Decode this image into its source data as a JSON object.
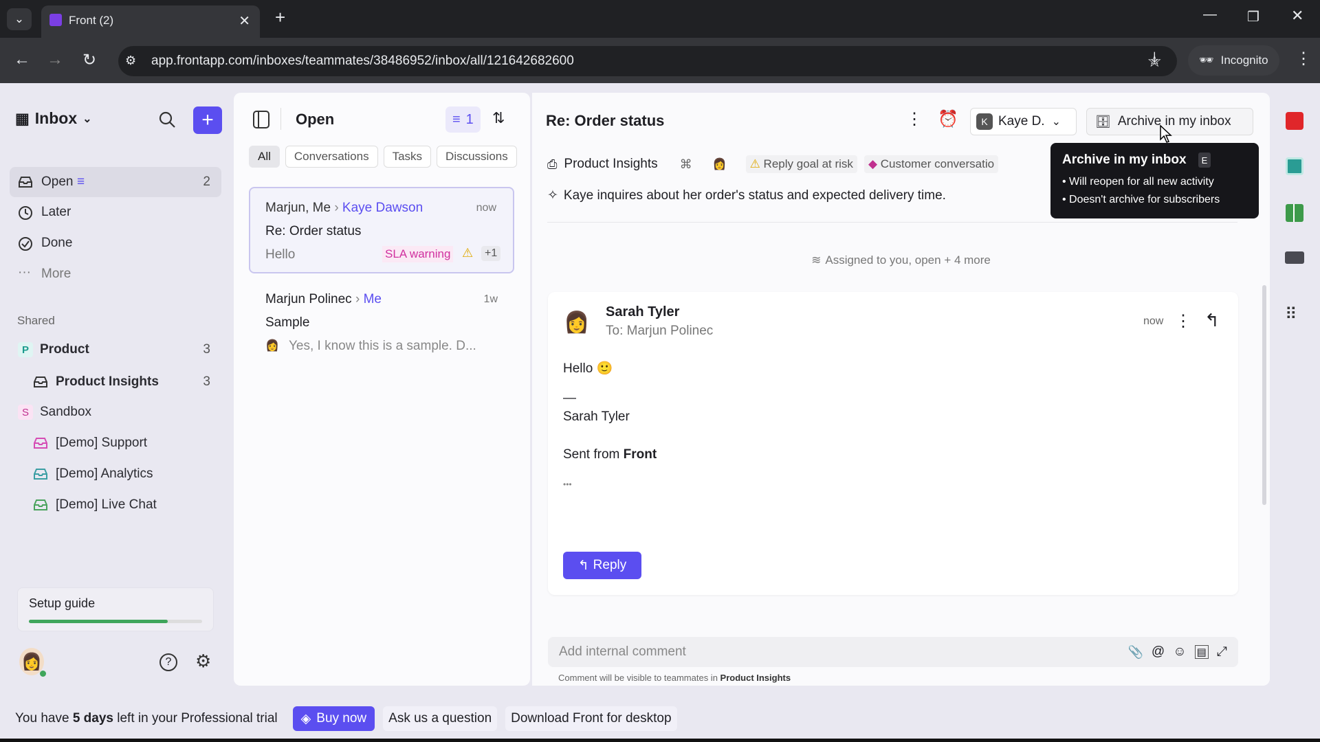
{
  "browser": {
    "tab_title": "Front (2)",
    "url": "app.frontapp.com/inboxes/teammates/38486952/inbox/all/121642682600",
    "incognito_label": "Incognito"
  },
  "sidebar": {
    "title": "Inbox",
    "items": [
      {
        "label": "Open",
        "count": "2"
      },
      {
        "label": "Later"
      },
      {
        "label": "Done"
      },
      {
        "label": "More"
      }
    ],
    "shared_label": "Shared",
    "shared": [
      {
        "badge": "P",
        "label": "Product",
        "count": "3"
      },
      {
        "label": "Product Insights",
        "count": "3"
      },
      {
        "badge": "S",
        "label": "Sandbox"
      },
      {
        "label": "[Demo] Support"
      },
      {
        "label": "[Demo] Analytics"
      },
      {
        "label": "[Demo] Live Chat"
      }
    ],
    "setup_guide": {
      "label": "Setup guide",
      "progress": 0.8
    }
  },
  "list": {
    "title": "Open",
    "filter_count": "1",
    "tabs": [
      "All",
      "Conversations",
      "Tasks",
      "Discussions"
    ],
    "items": [
      {
        "from": "Marjun, Me",
        "to": "Kaye Dawson",
        "time": "now",
        "subject": "Re: Order status",
        "preview": "Hello",
        "badge": "SLA warning",
        "extra": "+1"
      },
      {
        "from": "Marjun Polinec",
        "to": "Me",
        "time": "1w",
        "subject": "Sample",
        "preview": "Yes, I know this is a sample. D..."
      }
    ]
  },
  "conversation": {
    "title": "Re: Order status",
    "assignee": "Kaye D.",
    "assignee_initial": "K",
    "archive_label": "Archive in my inbox",
    "inbox_tag": "Product Insights",
    "tags": [
      "Reply goal at risk",
      "Customer conversatio"
    ],
    "summary": "Kaye inquires about her order's status and expected delivery time.",
    "status_line": "Assigned to you, open + 4 more",
    "message": {
      "sender": "Sarah Tyler",
      "to": "To: Marjun Polinec",
      "time": "now",
      "greeting": "Hello",
      "dash": "—",
      "signature": "Sarah Tyler",
      "sent_from": "Sent from ",
      "sent_app": "Front",
      "ellipsis": "•••",
      "reply_label": "Reply"
    },
    "comment_placeholder": "Add internal comment",
    "comment_hint": "Comment will be visible to teammates in ",
    "comment_hint_inbox": "Product Insights"
  },
  "tooltip": {
    "title": "Archive in my inbox",
    "shortcut": "E",
    "bullets": [
      "Will reopen for all new activity",
      "Doesn't archive for subscribers"
    ]
  },
  "trial": {
    "prefix": "You have ",
    "days": "5 days",
    "suffix": " left in your Professional trial",
    "buy": "Buy now",
    "ask": "Ask us a question",
    "download": "Download Front for desktop"
  },
  "colors": {
    "accent": "#5b4ef0",
    "progress": "#3fa55b"
  }
}
